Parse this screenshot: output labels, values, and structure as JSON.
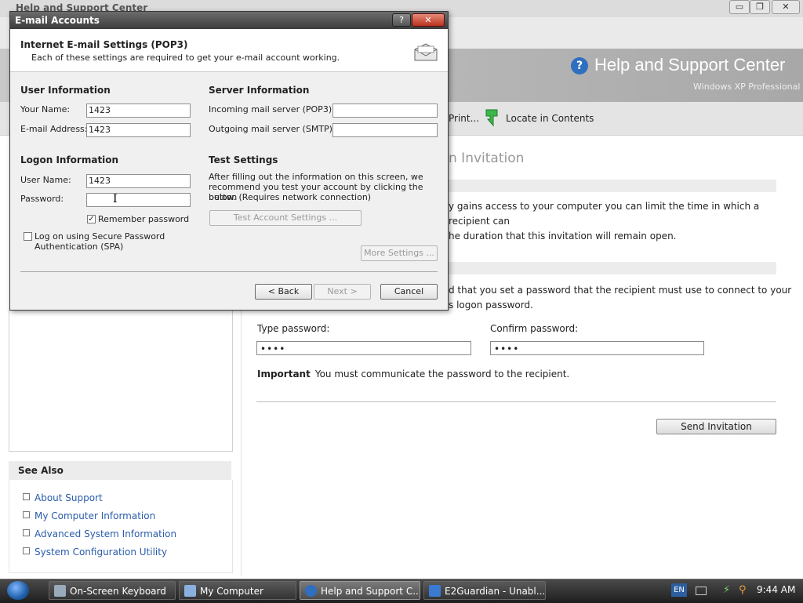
{
  "hsc": {
    "window_title": "Help and Support Center",
    "controls": {
      "minimize": "▭",
      "restore": "❐",
      "close": "✕"
    },
    "banner_title": "Help and Support Center",
    "banner_subtitle": "Windows XP Professional",
    "toolbar": {
      "print": "Print...",
      "locate": "Locate in Contents"
    },
    "page_heading": "n Invitation",
    "para1": [
      "y gains access to your computer you can limit the time in which a recipient can",
      "he duration that this invitation will remain open."
    ],
    "para2": [
      "d that you set a password that the recipient must use to connect to your",
      "s logon password."
    ],
    "type_password_label": "Type password:",
    "type_password_value": "••••",
    "confirm_password_label": "Confirm password:",
    "confirm_password_value": "••••",
    "important_label": "Important",
    "important_text": "You must communicate the password to the recipient.",
    "send_button": "Send Invitation",
    "see_also": {
      "title": "See Also",
      "items": [
        "About Support",
        "My Computer Information",
        "Advanced System Information",
        "System Configuration Utility"
      ]
    }
  },
  "dialog": {
    "title": "E-mail Accounts",
    "help": "?",
    "close": "✕",
    "heading": "Internet E-mail Settings (POP3)",
    "subheading": "Each of these settings are required to get your e-mail account working.",
    "user_info": {
      "title": "User Information",
      "name_label": "Your Name:",
      "name_value": "1423",
      "email_label": "E-mail Address:",
      "email_value": "1423"
    },
    "logon_info": {
      "title": "Logon Information",
      "username_label": "User Name:",
      "username_value": "1423",
      "password_label": "Password:",
      "password_value": "",
      "remember_label": "Remember password",
      "remember_checked": true,
      "spa_label_1": "Log on using Secure Password",
      "spa_label_2": "Authentication (SPA)",
      "spa_checked": false
    },
    "server_info": {
      "title": "Server Information",
      "incoming_label": "Incoming mail server (POP3):",
      "incoming_value": "",
      "outgoing_label": "Outgoing mail server (SMTP):",
      "outgoing_value": ""
    },
    "test_settings": {
      "title": "Test Settings",
      "text_1": "After filling out the information on this screen, we",
      "text_2": "recommend you test your account by clicking the button",
      "text_3": "below. (Requires network connection)",
      "button": "Test Account Settings ..."
    },
    "more_settings": "More Settings ...",
    "back": "< Back",
    "next": "Next >",
    "cancel": "Cancel"
  },
  "taskbar": {
    "tasks": [
      "On-Screen Keyboard",
      "My Computer",
      "Help and Support C...",
      "E2Guardian - Unabl..."
    ],
    "language": "EN",
    "time": "9:44 AM"
  }
}
